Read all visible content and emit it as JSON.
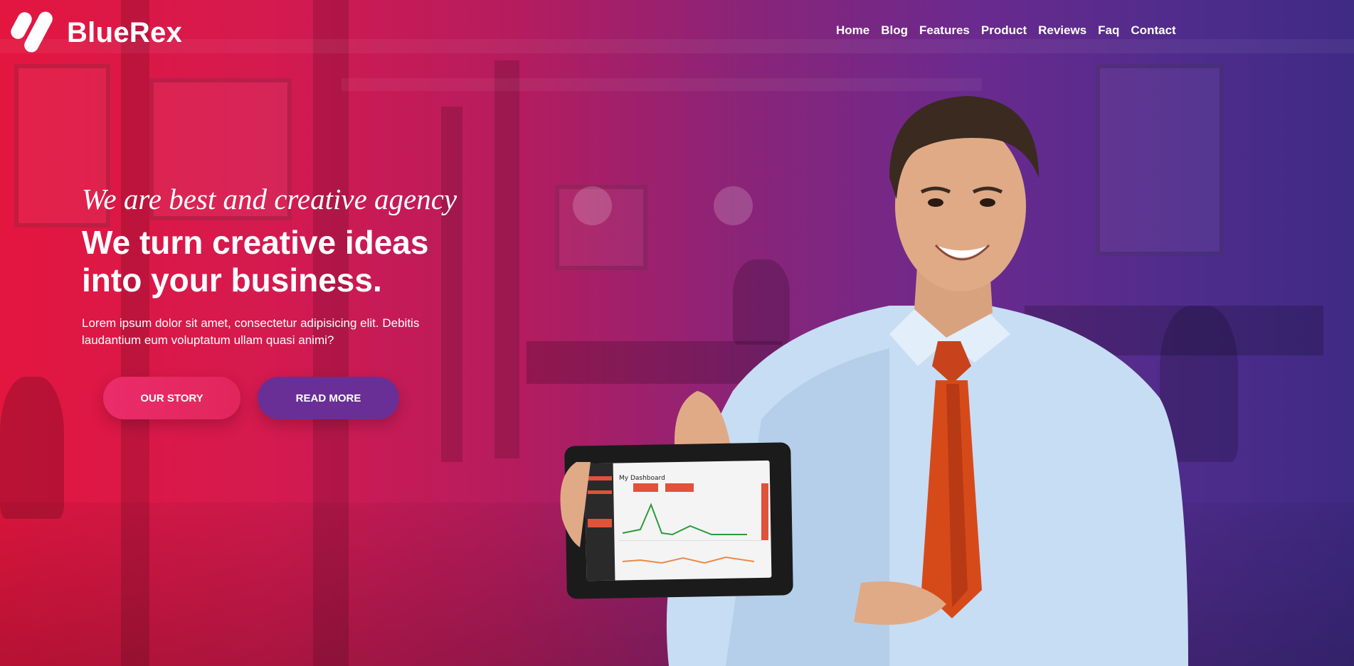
{
  "brand": {
    "name": "BlueRex"
  },
  "nav": {
    "items": [
      "Home",
      "Blog",
      "Features",
      "Product",
      "Reviews",
      "Faq",
      "Contact"
    ]
  },
  "hero": {
    "tagline": "We are best and creative agency",
    "headline_line1": "We turn creative ideas",
    "headline_line2": "into your business.",
    "description_line1": "Lorem ipsum dolor sit amet, consectetur adipisicing elit. Debitis",
    "description_line2": "laudantium eum voluptatum ullam quasi animi?",
    "primary_button": "OUR STORY",
    "secondary_button": "READ MORE"
  },
  "tablet": {
    "dashboard_title": "My Dashboard"
  },
  "colors": {
    "gradient_start": "#e3163f",
    "gradient_end": "#3f2a84",
    "button_story": "#e2265c",
    "button_read": "#6a2f96"
  }
}
